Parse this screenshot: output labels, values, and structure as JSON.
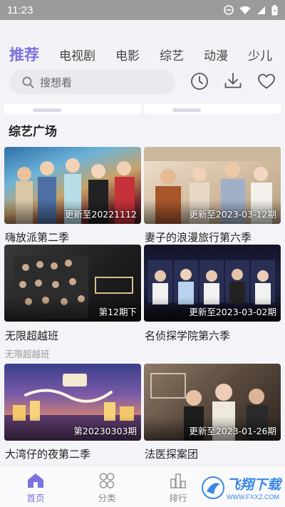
{
  "status_bar": {
    "time": "11:23"
  },
  "tabs": [
    {
      "label": "推荐",
      "active": true
    },
    {
      "label": "电视剧"
    },
    {
      "label": "电影"
    },
    {
      "label": "综艺"
    },
    {
      "label": "动漫"
    },
    {
      "label": "少儿"
    }
  ],
  "search": {
    "placeholder": "搜想看"
  },
  "header_icons": [
    "history-icon",
    "download-icon",
    "favorite-icon"
  ],
  "section": {
    "title": "综艺广场"
  },
  "cards": [
    {
      "badge": "更新至20221112",
      "title": "嗨放派第二季",
      "subtitle": ""
    },
    {
      "badge": "更新至2023-03-12期",
      "title": "妻子的浪漫旅行第六季",
      "subtitle": ""
    },
    {
      "badge": "第12期下",
      "title": "无限超越班",
      "subtitle": "无限超越班"
    },
    {
      "badge": "更新至2023-03-02期",
      "title": "名侦探学院第六季",
      "subtitle": ""
    },
    {
      "badge": "第20230303期",
      "title": "大湾仔的夜第二季",
      "subtitle": ""
    },
    {
      "badge": "更新至2023-01-26期",
      "title": "法医探案团",
      "subtitle": ""
    }
  ],
  "bottom_nav": [
    {
      "label": "首页",
      "active": true
    },
    {
      "label": "分类"
    },
    {
      "label": "排行"
    }
  ],
  "watermark": {
    "text": "飞翔下载",
    "url": "WWW.FXXZ.COM"
  },
  "colors": {
    "accent": "#7a73e0",
    "status_bar": "#9b9b9b",
    "watermark": "#3a87e6"
  }
}
